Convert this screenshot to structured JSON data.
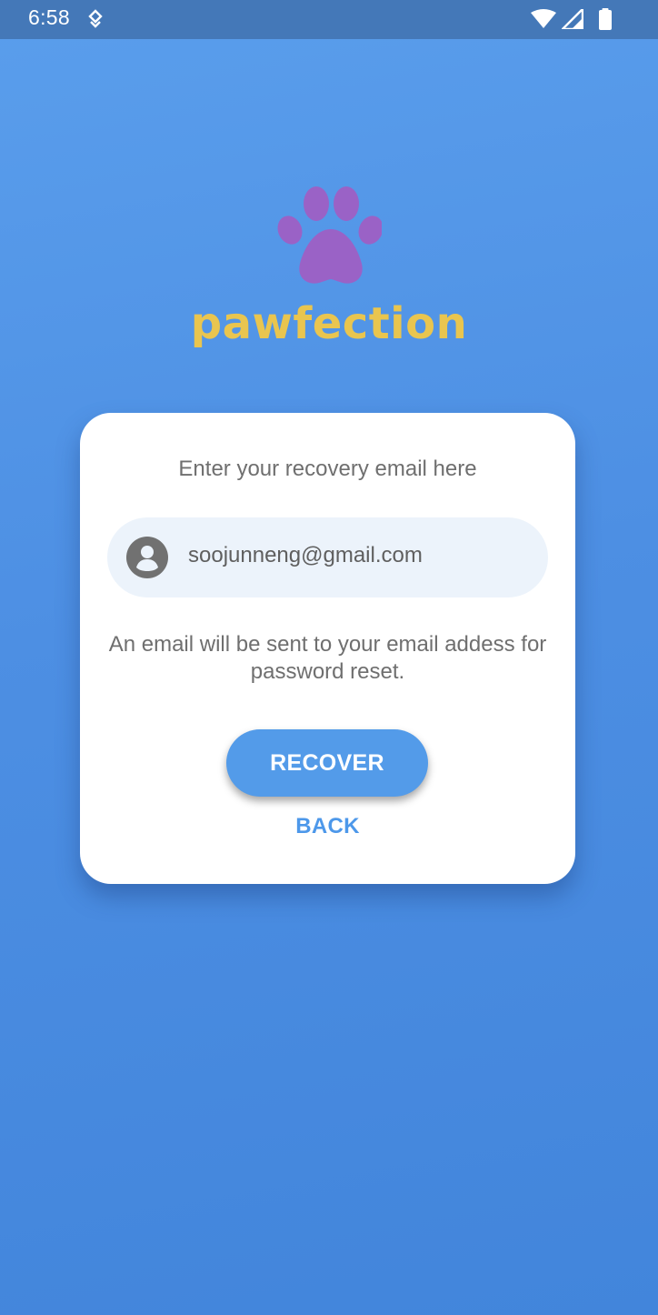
{
  "status_bar": {
    "time": "6:58"
  },
  "logo": {
    "app_name": "pawfection"
  },
  "recovery_card": {
    "title": "Enter your recovery email here",
    "email_value": "soojunneng@gmail.com",
    "email_icon": "account-circle-icon",
    "info_text": "An email will be sent to your email addess for password reset.",
    "recover_label": "RECOVER",
    "back_label": "BACK"
  },
  "colors": {
    "background": "#4d8fe3",
    "status_bar": "#4478b8",
    "paw": "#9a62c6",
    "brand_text": "#e9c54f",
    "button": "#539be9",
    "back_link": "#4d98ea",
    "field_bg": "#ecf3fb"
  }
}
